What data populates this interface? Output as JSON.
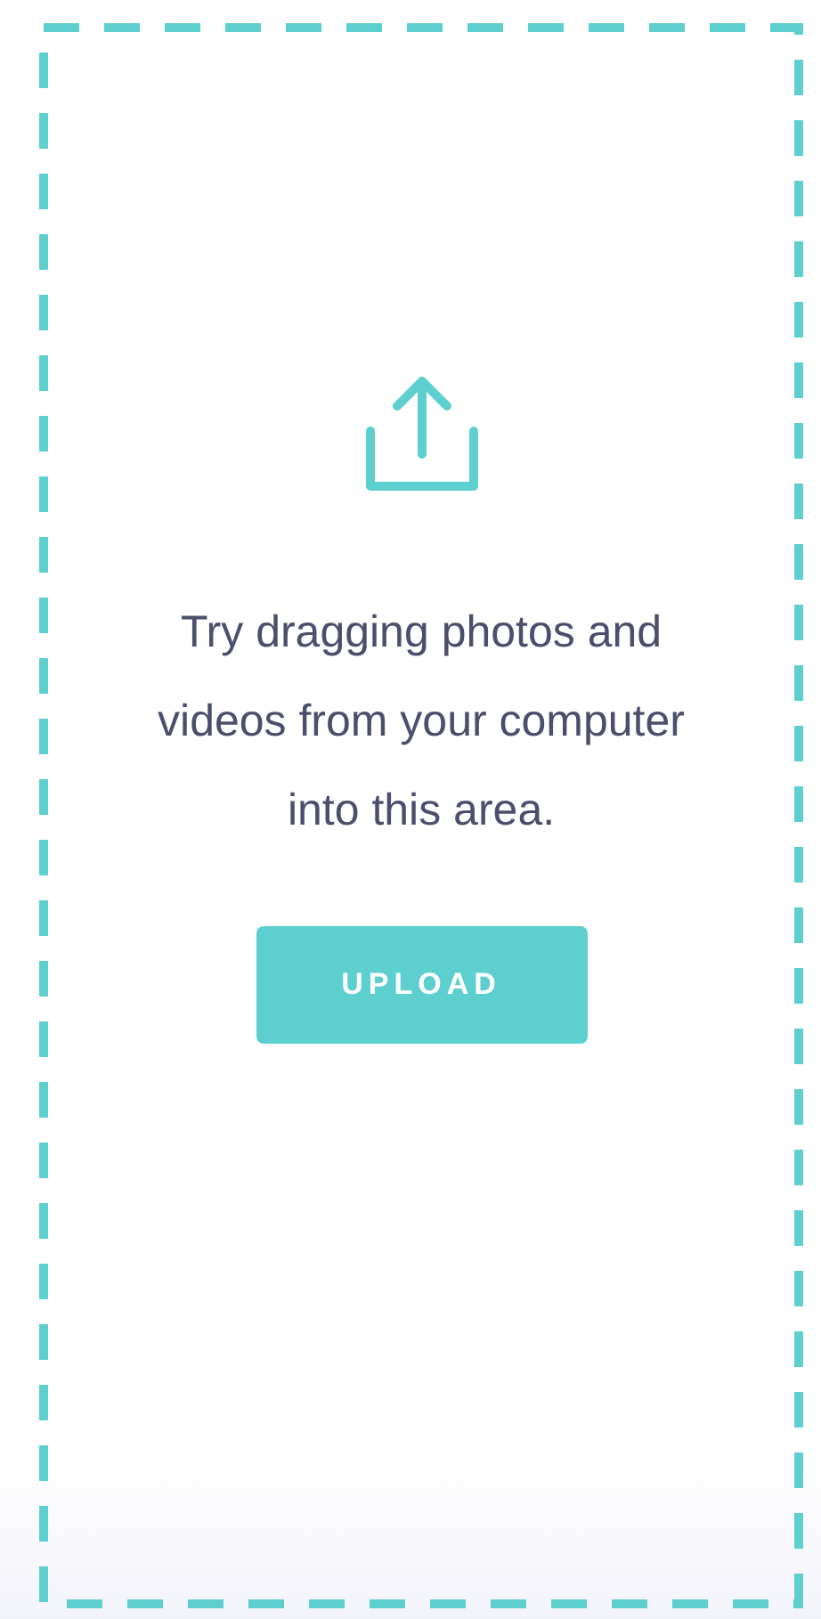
{
  "drop_zone": {
    "message": "Try dragging photos and videos from your computer into this area.",
    "upload_button": "UPLOAD"
  }
}
